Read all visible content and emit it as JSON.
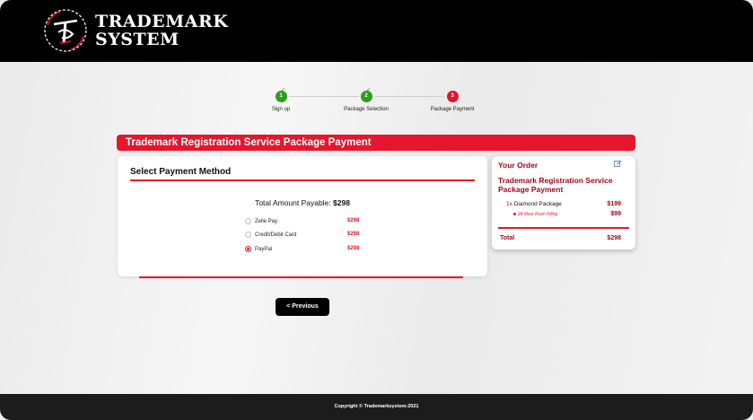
{
  "brand": {
    "line1": "TRADEMARK",
    "line2": "SYSTEM"
  },
  "stepper": {
    "steps": [
      {
        "number": "1",
        "label": "Sign up",
        "state": "done"
      },
      {
        "number": "2",
        "label": "Package Selection",
        "state": "done"
      },
      {
        "number": "3",
        "label": "Package Payment",
        "state": "active"
      }
    ]
  },
  "banner": {
    "title": "Trademark Registration Service Package Payment"
  },
  "payment": {
    "heading": "Select Payment Method",
    "total_label": "Total Amount Payable: ",
    "total_value": "$298",
    "options": [
      {
        "label": "Zelle Pay",
        "price": "$298",
        "selected": false
      },
      {
        "label": "Credit/Debit Card",
        "price": "$298",
        "selected": false
      },
      {
        "label": "PayPal",
        "price": "$298",
        "selected": true
      }
    ]
  },
  "order": {
    "heading": "Your Order",
    "package_title": "Trademark Registration Service Package Payment",
    "items": [
      {
        "qty": "1x",
        "name": "Diamond Package",
        "price": "$199"
      },
      {
        "name": "24 Hour Rush Filing",
        "price": "$99"
      }
    ],
    "total_label": "Total",
    "total_value": "$298"
  },
  "nav": {
    "previous_label": "< Previous"
  },
  "footer": {
    "copyright": "Copyright © Trademarksystem-2021"
  },
  "colors": {
    "accent": "#e5162e",
    "dark_red": "#a1061a",
    "success": "#2e9e1a",
    "header_bg": "#000000"
  }
}
